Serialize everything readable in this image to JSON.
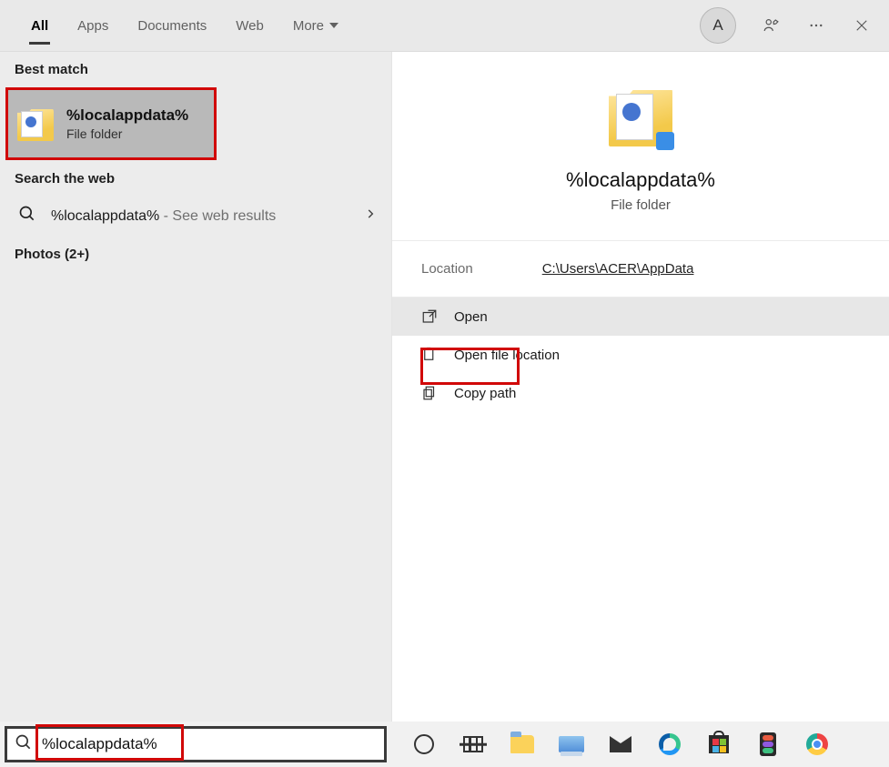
{
  "header": {
    "tabs": [
      "All",
      "Apps",
      "Documents",
      "Web",
      "More"
    ],
    "avatar_letter": "A"
  },
  "left": {
    "best_match_label": "Best match",
    "best_match": {
      "title": "%localappdata%",
      "subtitle": "File folder"
    },
    "search_web_label": "Search the web",
    "web_result": {
      "term": "%localappdata%",
      "suffix": " - See web results"
    },
    "photos_label": "Photos (2+)"
  },
  "right": {
    "title": "%localappdata%",
    "subtitle": "File folder",
    "location_label": "Location",
    "location_value": "C:\\Users\\ACER\\AppData",
    "actions": {
      "open": "Open",
      "open_location": "Open file location",
      "copy_path": "Copy path"
    }
  },
  "search": {
    "value": "%localappdata%"
  }
}
